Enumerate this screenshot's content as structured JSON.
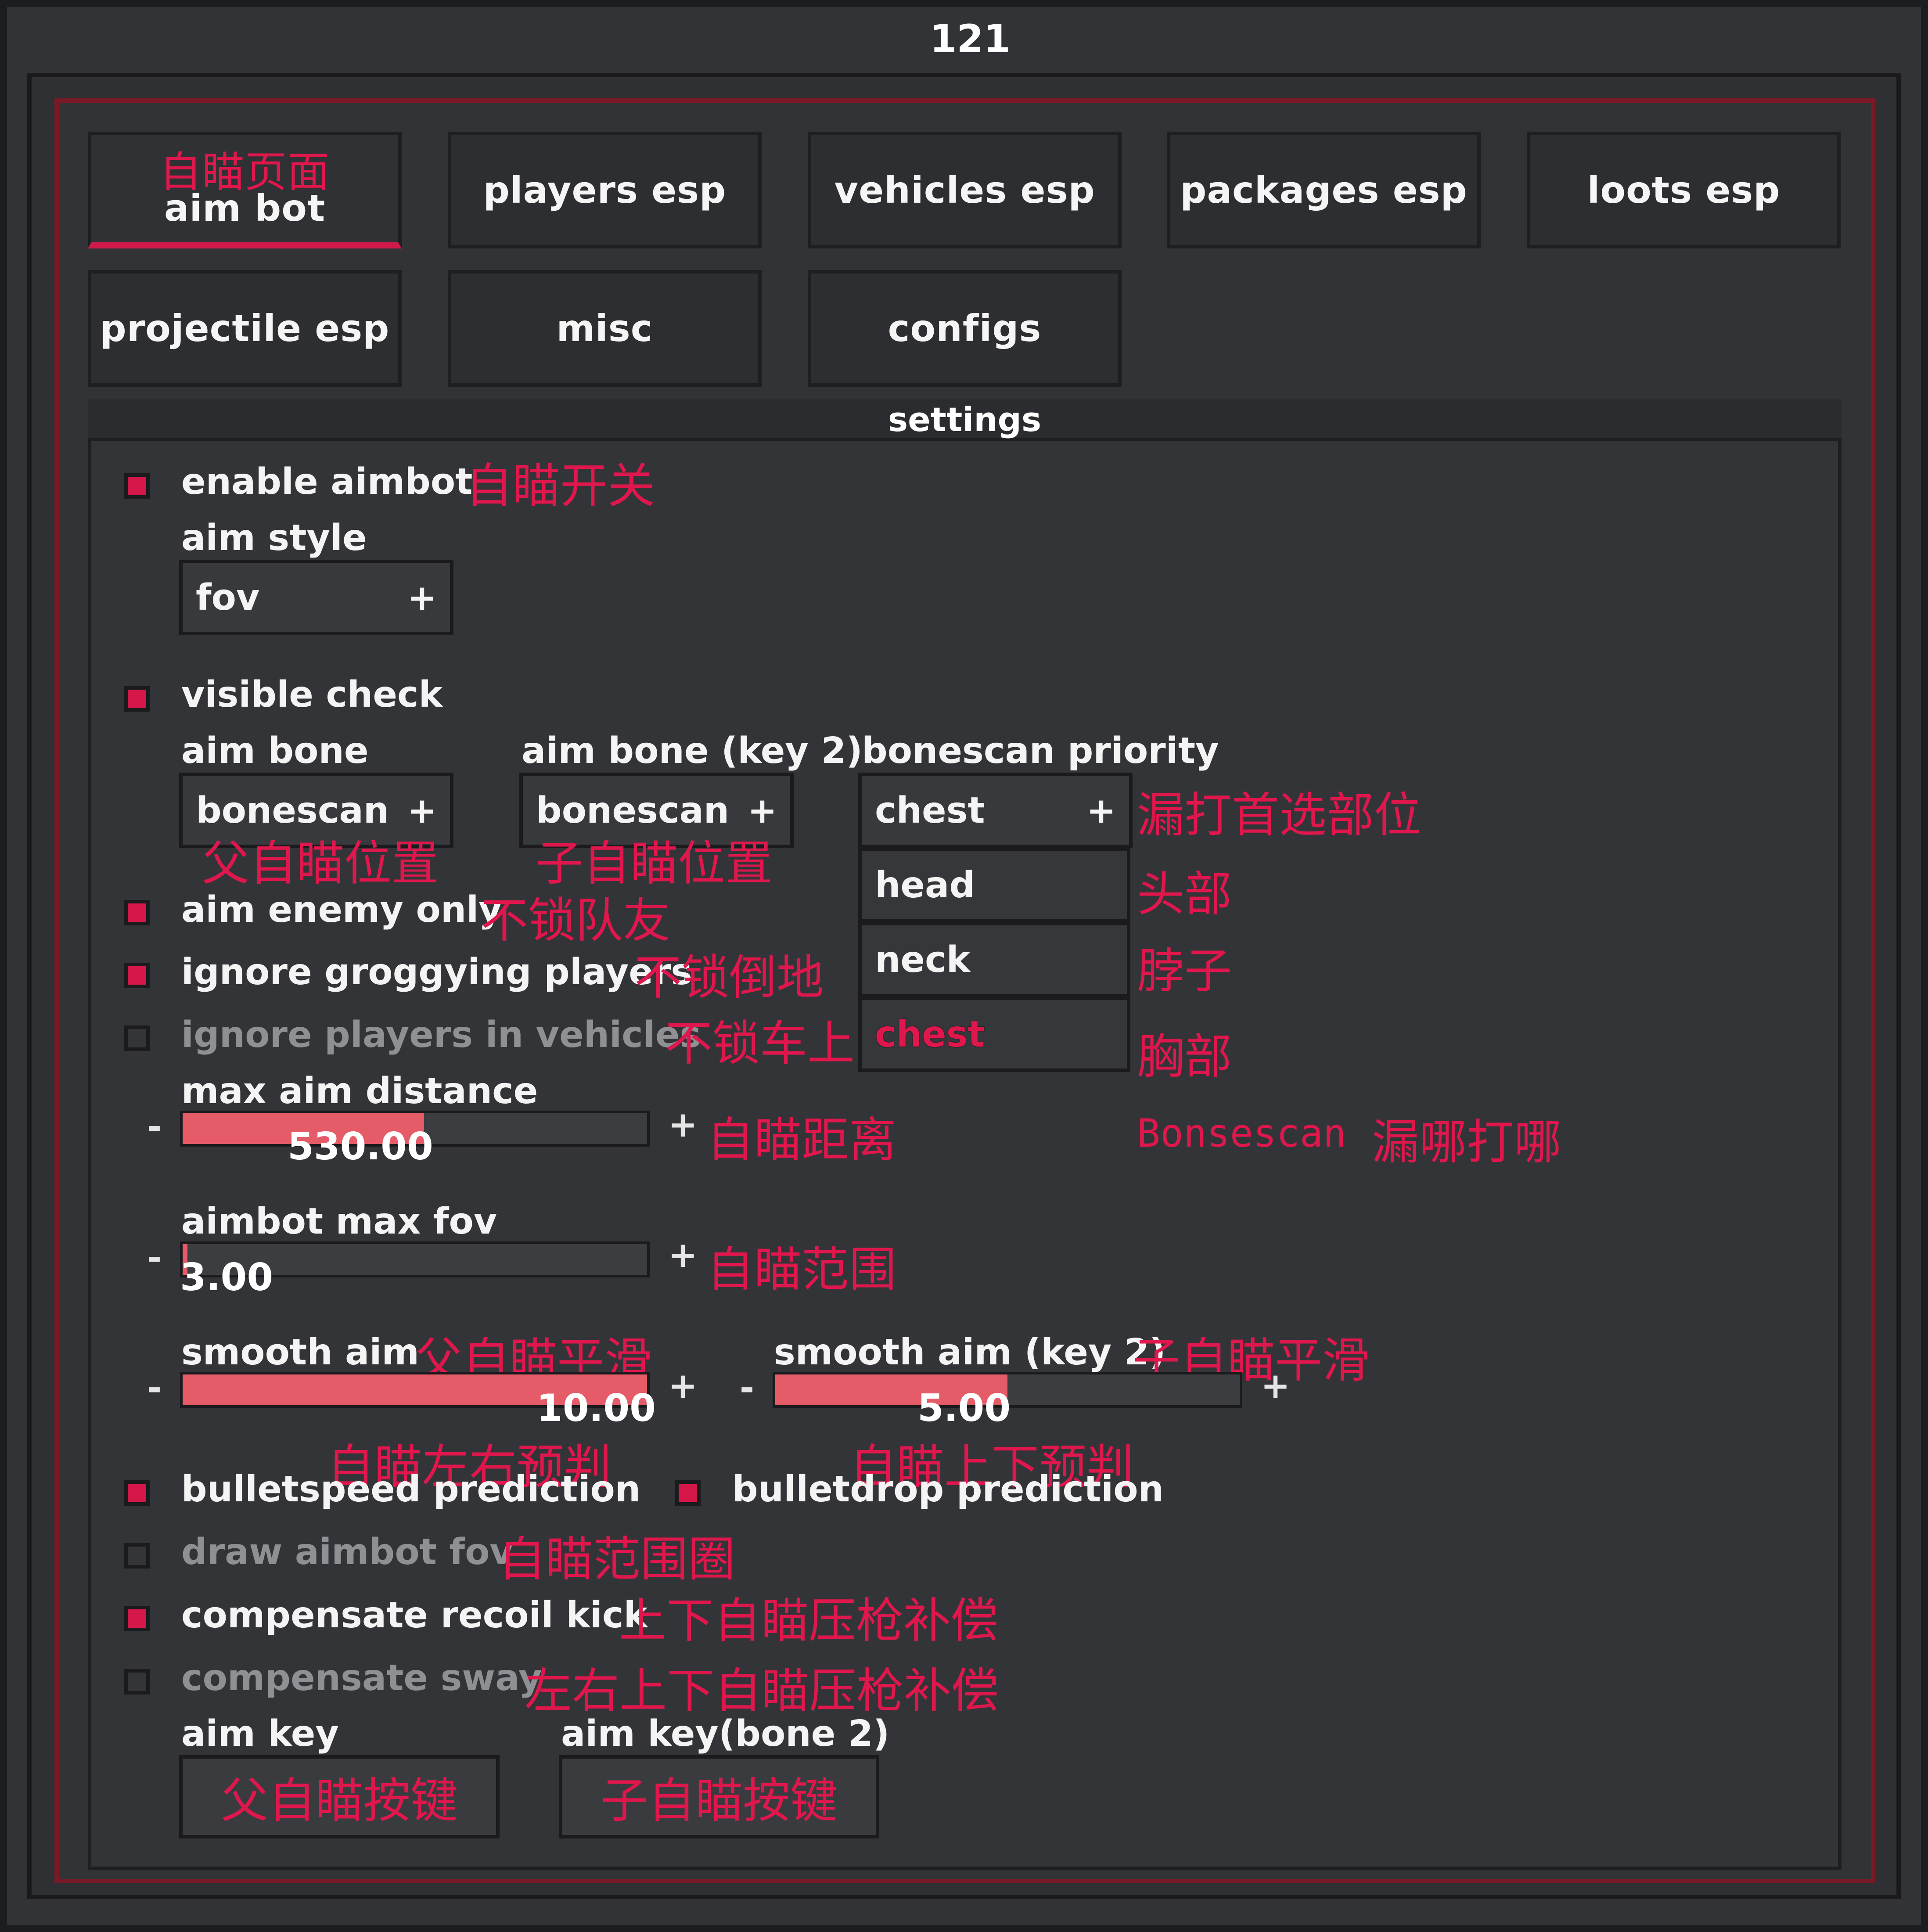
{
  "window": {
    "title": "121"
  },
  "tabs": [
    {
      "label": "aim bot",
      "note": "自瞄页面",
      "active": true
    },
    {
      "label": "players esp"
    },
    {
      "label": "vehicles esp"
    },
    {
      "label": "packages esp"
    },
    {
      "label": "loots esp"
    },
    {
      "label": "projectile esp"
    },
    {
      "label": "misc"
    },
    {
      "label": "configs"
    }
  ],
  "settings": {
    "title": "settings",
    "enable_aimbot": {
      "label": "enable aimbot",
      "checked": true,
      "note": "自瞄开关"
    },
    "aim_style": {
      "label": "aim style",
      "value": "fov",
      "expand_icon": "+"
    },
    "visible_check": {
      "label": "visible check",
      "checked": true
    },
    "aim_bone": {
      "label": "aim bone",
      "value": "bonescan",
      "expand_icon": "+",
      "note": "父自瞄位置"
    },
    "aim_bone_key2": {
      "label": "aim bone (key 2)",
      "value": "bonescan",
      "expand_icon": "+",
      "note": "子自瞄位置"
    },
    "bonescan_priority": {
      "label": "bonescan priority",
      "value": "chest",
      "expand_icon": "+",
      "note": "漏打首选部位",
      "options": [
        {
          "label": "head",
          "note": "头部"
        },
        {
          "label": "neck",
          "note": "脖子"
        },
        {
          "label": "chest",
          "note": "胸部"
        }
      ],
      "footer_note_latin": "Bonsescan",
      "footer_note": "漏哪打哪"
    },
    "aim_enemy_only": {
      "label": "aim enemy only",
      "checked": true,
      "note": "不锁队友"
    },
    "ignore_groggying": {
      "label": "ignore groggying players",
      "checked": true,
      "note": "不锁倒地"
    },
    "ignore_vehicles": {
      "label": "ignore players in vehicles",
      "checked": false,
      "note": "不锁车上"
    },
    "max_aim_distance": {
      "label": "max aim distance",
      "value": "530.00",
      "fill": 0.52,
      "note": "自瞄距离",
      "minus": "-",
      "plus": "+"
    },
    "aimbot_max_fov": {
      "label": "aimbot max fov",
      "value": "3.00",
      "fill": 0.01,
      "note": "自瞄范围",
      "minus": "-",
      "plus": "+"
    },
    "smooth_aim": {
      "label": "smooth aim",
      "value": "10.00",
      "fill": 1.0,
      "note": "父自瞄平滑",
      "minus": "-",
      "plus": "+"
    },
    "smooth_aim_key2": {
      "label": "smooth aim (key 2)",
      "value": "5.00",
      "fill": 0.5,
      "note": "子自瞄平滑",
      "minus": "-",
      "plus": "+"
    },
    "bulletspeed_prediction": {
      "label": "bulletspeed prediction",
      "checked": true,
      "note": "自瞄左右预判"
    },
    "bulletdrop_prediction": {
      "label": "bulletdrop prediction",
      "checked": true,
      "note": "自瞄上下预判"
    },
    "draw_aimbot_fov": {
      "label": "draw aimbot fov",
      "checked": false,
      "note": "自瞄范围圈"
    },
    "compensate_recoil": {
      "label": "compensate recoil kick",
      "checked": true,
      "note": "上下自瞄压枪补偿"
    },
    "compensate_sway": {
      "label": "compensate sway",
      "checked": false,
      "note": "左右上下自瞄压枪补偿"
    },
    "aim_key": {
      "label": "aim key",
      "value": "父自瞄按键"
    },
    "aim_key_bone2": {
      "label": "aim key(bone 2)",
      "value": "子自瞄按键"
    }
  },
  "colors": {
    "accent": "#d6174a",
    "annotation": "#e0174d",
    "slider_fill": "#e55b68",
    "background": "#323336"
  }
}
